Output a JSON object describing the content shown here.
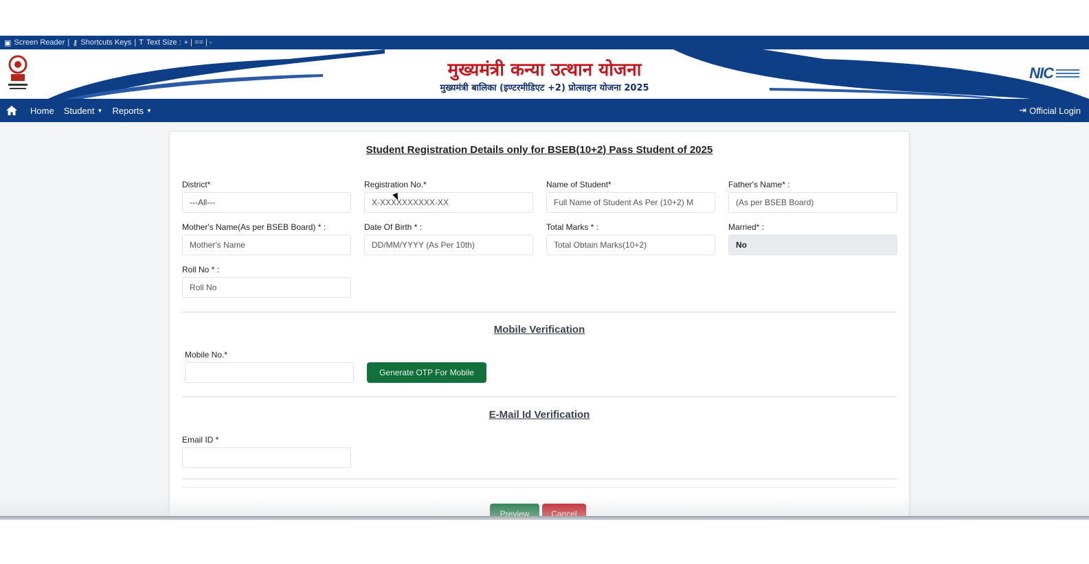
{
  "a11y_bar": {
    "screen_reader": "Screen Reader",
    "shortcut_keys": "Shortcuts Keys",
    "text_size": "Text Size :",
    "text_size_controls": "+ | == | -"
  },
  "header": {
    "title_hindi": "मुख्यमंत्री कन्या उत्थान योजना",
    "subtitle_hindi": "मुख्यमंत्री बालिका (इण्टरमीडिएट +2) प्रोत्साहन योजना 2025",
    "nic_logo": "NIC"
  },
  "nav": {
    "home": "Home",
    "student": "Student",
    "reports": "Reports",
    "official_login": "Official Login"
  },
  "form": {
    "title": "Student Registration Details only for BSEB(10+2) Pass Student of 2025",
    "district": {
      "label": "District*",
      "value": "---All---"
    },
    "registration_no": {
      "label": "Registration No.*",
      "placeholder": "X-XXXXXXXXXX-XX"
    },
    "student_name": {
      "label": "Name of Student*",
      "placeholder": "Full Name of Student As Per (10+2) M"
    },
    "father_name": {
      "label": "Father's Name* :",
      "placeholder": "(As per BSEB Board)"
    },
    "mother_name": {
      "label": "Mother's Name(As per BSEB Board) * :",
      "placeholder": "Mother's Name"
    },
    "dob": {
      "label": "Date Of Birth * :",
      "placeholder": "DD/MM/YYYY (As Per 10th)"
    },
    "total_marks": {
      "label": "Total Marks * :",
      "placeholder": "Total Obtain Marks(10+2)"
    },
    "married": {
      "label": "Married* :",
      "value": "No"
    },
    "roll_no": {
      "label": "Roll No * :",
      "placeholder": "Roll No"
    }
  },
  "mobile_section": {
    "title": "Mobile Verification",
    "mobile_label": "Mobile No.*",
    "otp_button": "Generate OTP For Mobile"
  },
  "email_section": {
    "title": "E-Mail Id Verification",
    "email_label": "Email ID *"
  },
  "actions": {
    "preview": "Preview",
    "cancel": "Cancel"
  },
  "colors": {
    "primary_blue": "#0e3f86",
    "title_red": "#c4161c",
    "button_green": "#12703a",
    "button_red": "#c0141c"
  }
}
